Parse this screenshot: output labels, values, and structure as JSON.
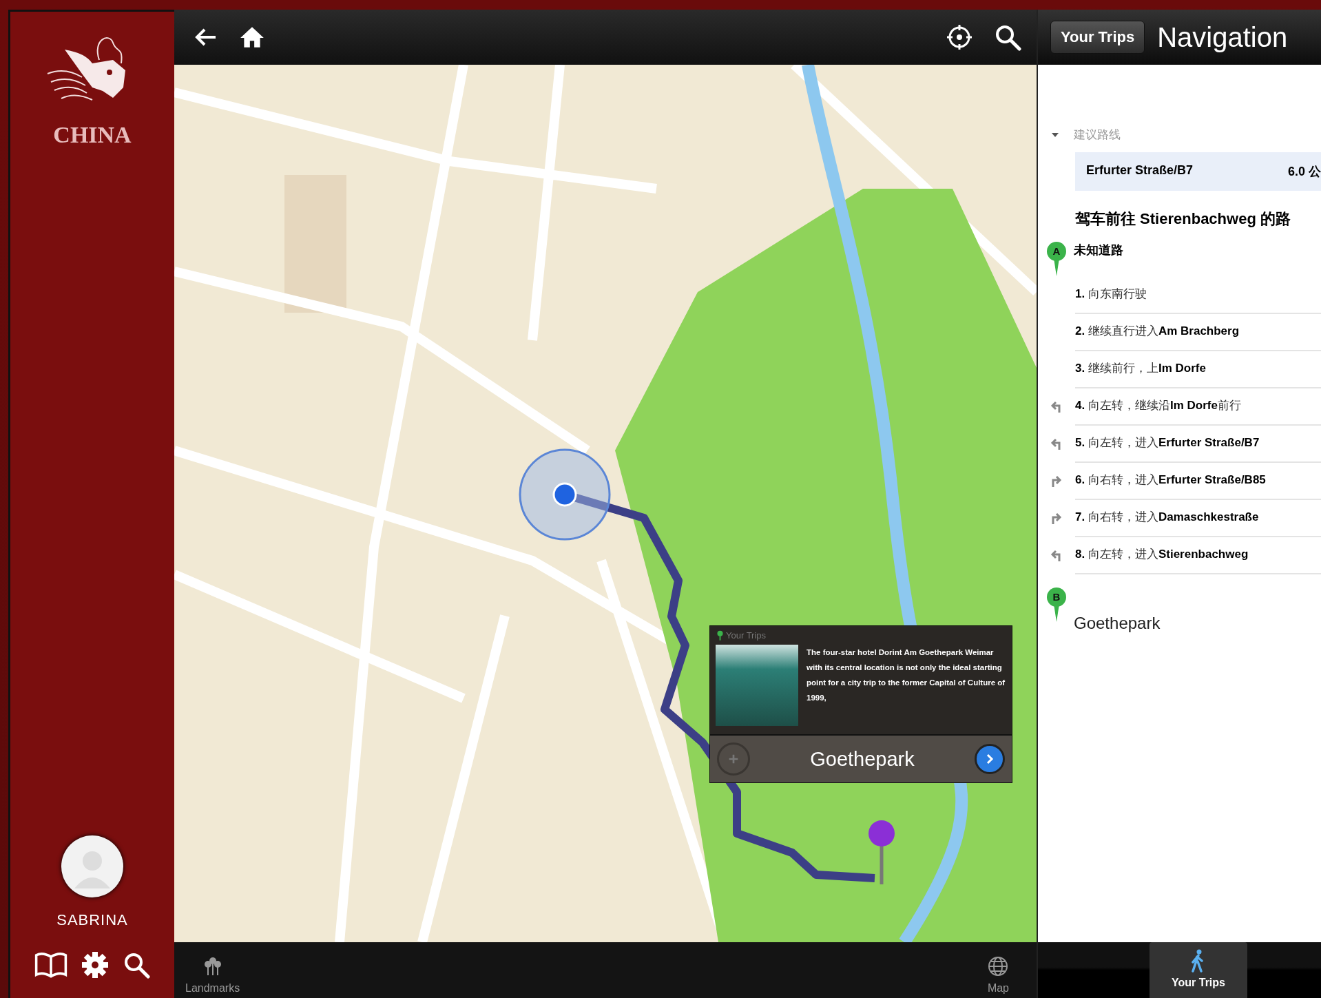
{
  "sidebar": {
    "logo_text": "CHINA",
    "user_name": "SABRINA"
  },
  "map": {
    "popup": {
      "header": "Your Trips",
      "description": "The four-star hotel Dorint Am Goethepark Weimar with its central location is not only the ideal starting point for a city trip to the former Capital of Culture of 1999,",
      "title": "Goethepark"
    }
  },
  "map_tabs": [
    {
      "label": "Landmarks",
      "kind": "landmarks",
      "selected": false
    },
    {
      "label": "Map",
      "kind": "globe",
      "selected": false
    }
  ],
  "navigation": {
    "back_button": "Your Trips",
    "title": "Navigation",
    "section_label": "建议路线",
    "expanded": true,
    "route": {
      "name": "Erfurter Straße/B7",
      "distance": "6.0 公"
    },
    "heading": "驾车前往 Stierenbachweg 的路",
    "start": {
      "marker": "A",
      "name": "未知道路"
    },
    "steps": [
      {
        "text": "**1.** 向东南行驶",
        "kind": "straight"
      },
      {
        "text": "**2.** 继续直行进入**Am Brachberg**",
        "kind": "straight"
      },
      {
        "text": "**3.** 继续前行，上**Im Dorfe**",
        "kind": "straight"
      },
      {
        "text": "**4.** 向左转，继续沿**Im Dorfe**前行",
        "kind": "left"
      },
      {
        "text": "**5.** 向左转，进入**Erfurter Straße/B7**",
        "kind": "left"
      },
      {
        "text": "**6.** 向右转，进入**Erfurter Straße/B85**",
        "kind": "right"
      },
      {
        "text": "**7.** 向右转，进入**Damaschkestraße**",
        "kind": "right"
      },
      {
        "text": "**8.** 向左转，进入**Stierenbachweg**",
        "kind": "left"
      }
    ],
    "end": {
      "marker": "B",
      "name": "Goethepark"
    }
  },
  "nav_tabs": [
    {
      "label": "Your Trips",
      "selected": true
    }
  ]
}
